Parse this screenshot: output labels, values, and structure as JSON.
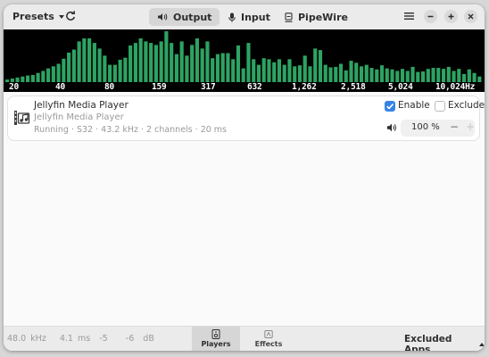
{
  "header": {
    "presets_label": "Presets",
    "tabs": [
      {
        "label": "Output",
        "icon": "speaker-icon",
        "active": true
      },
      {
        "label": "Input",
        "icon": "microphone-icon",
        "active": false
      },
      {
        "label": "PipeWire",
        "icon": "pipewire-icon",
        "active": false
      }
    ],
    "window_controls": [
      "menu-icon",
      "minimize-icon",
      "maximize-icon",
      "close-icon"
    ]
  },
  "spectrum": {
    "bar_color": "#2ea363",
    "background": "#000000",
    "levels": [
      0.05,
      0.07,
      0.09,
      0.11,
      0.13,
      0.14,
      0.18,
      0.22,
      0.27,
      0.31,
      0.36,
      0.46,
      0.58,
      0.64,
      0.8,
      0.86,
      0.86,
      0.77,
      0.66,
      0.52,
      0.34,
      0.34,
      0.44,
      0.48,
      0.72,
      0.77,
      0.86,
      0.8,
      0.77,
      0.73,
      0.8,
      1.0,
      0.77,
      0.55,
      0.8,
      0.52,
      0.73,
      0.86,
      0.66,
      0.8,
      0.47,
      0.55,
      0.57,
      0.57,
      0.45,
      0.72,
      0.27,
      0.77,
      0.45,
      0.34,
      0.47,
      0.45,
      0.39,
      0.45,
      0.34,
      0.45,
      0.31,
      0.33,
      0.52,
      0.31,
      0.66,
      0.63,
      0.34,
      0.29,
      0.3,
      0.36,
      0.23,
      0.42,
      0.38,
      0.31,
      0.34,
      0.28,
      0.25,
      0.33,
      0.27,
      0.25,
      0.22,
      0.26,
      0.22,
      0.3,
      0.2,
      0.21,
      0.26,
      0.28,
      0.28,
      0.26,
      0.3,
      0.22,
      0.26,
      0.16,
      0.25,
      0.18,
      0.11
    ],
    "freq_labels": [
      "20",
      "40",
      "80",
      "159",
      "317",
      "632",
      "1,262",
      "2,518",
      "5,024",
      "10,024Hz"
    ]
  },
  "app": {
    "title": "Jellyfin Media Player",
    "media": "Jellyfin Media Player",
    "details": "Running · S32 · 43.2 kHz · 2 channels · 20 ms",
    "enable_label": "Enable",
    "enable_checked": true,
    "exclude_label": "Exclude",
    "exclude_checked": false,
    "volume": "100 %",
    "minus": "−",
    "plus": "+"
  },
  "footer": {
    "status": "48.0 kHz   4.1 ms  -5    -6  dB",
    "tabs": [
      {
        "label": "Players",
        "icon": "speaker-device-icon",
        "active": true
      },
      {
        "label": "Effects",
        "icon": "effects-icon",
        "active": false
      }
    ],
    "excluded_apps_label": "Excluded Apps"
  }
}
